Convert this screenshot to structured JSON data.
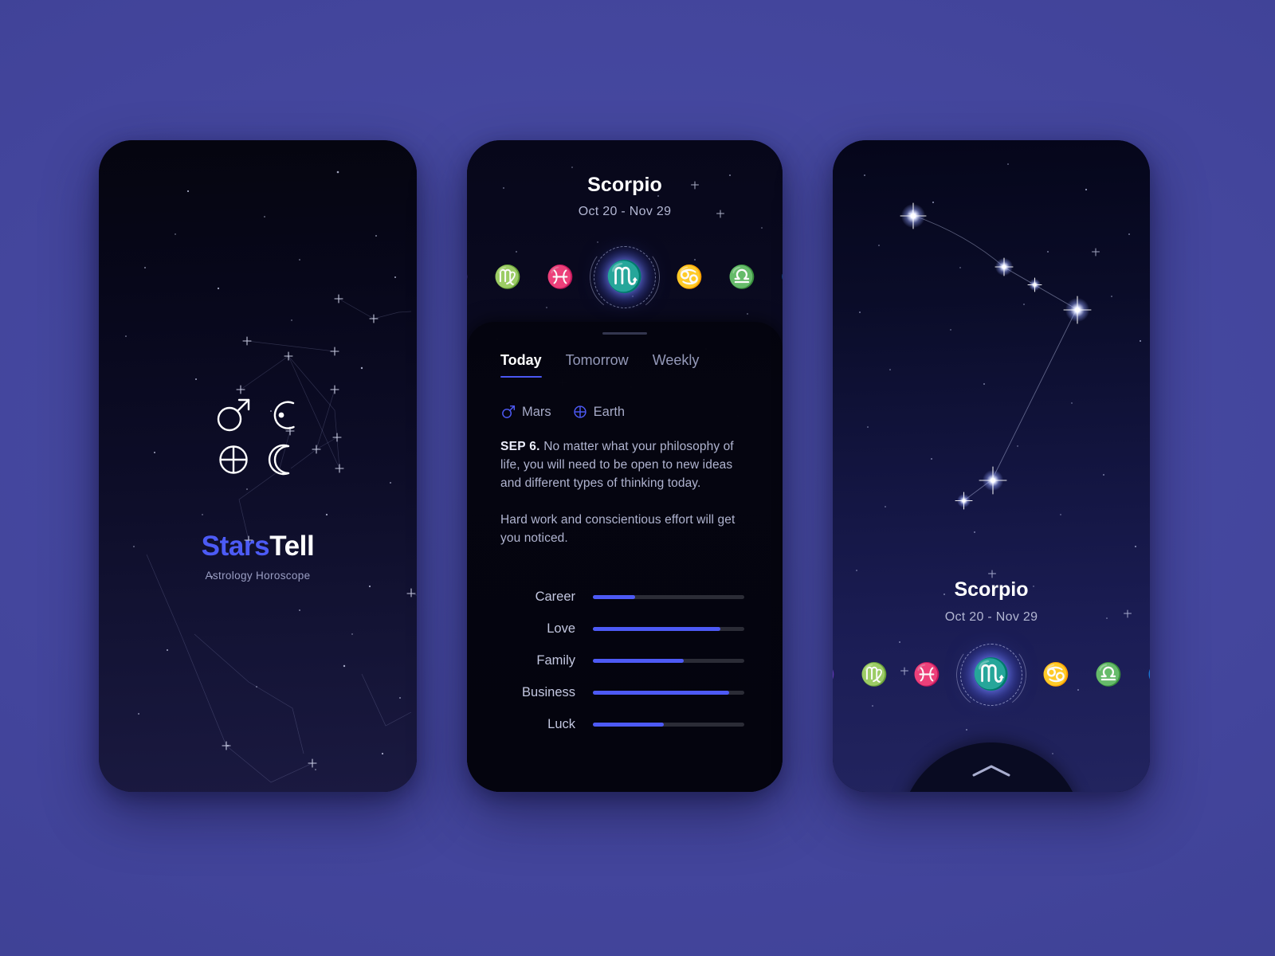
{
  "app": {
    "brand_primary": "Stars",
    "brand_secondary": "Tell",
    "tagline": "Astrology Horoscope",
    "accent_color": "#4d5af5",
    "page_background": "#43459c"
  },
  "splash": {
    "planet_icons": [
      "mars-icon",
      "sun-icon",
      "earth-icon",
      "moon-icon"
    ]
  },
  "detail": {
    "sign_name": "Scorpio",
    "sign_dates": "Oct 20 - Nov 29",
    "selected_glyph": "♏",
    "zodiac_rail": [
      {
        "name": "capricorn",
        "glyph": "♑",
        "dim": "edge"
      },
      {
        "name": "virgo",
        "glyph": "♍",
        "dim": "faint"
      },
      {
        "name": "pisces",
        "glyph": "♓",
        "dim": "normal"
      },
      {
        "name": "scorpio",
        "glyph": "♏",
        "dim": "selected"
      },
      {
        "name": "cancer",
        "glyph": "♋",
        "dim": "normal"
      },
      {
        "name": "libra",
        "glyph": "♎",
        "dim": "faint"
      },
      {
        "name": "sagittarius",
        "glyph": "♐",
        "dim": "edge"
      }
    ],
    "tabs": [
      {
        "label": "Today",
        "active": true
      },
      {
        "label": "Tomorrow",
        "active": false
      },
      {
        "label": "Weekly",
        "active": false
      }
    ],
    "planets": [
      {
        "name": "Mars",
        "icon": "mars-icon"
      },
      {
        "name": "Earth",
        "icon": "earth-icon"
      }
    ],
    "date_label": "SEP 6.",
    "paragraph_1": "No matter what your philosophy of life, you will need to be open to new ideas and different types of thinking today.",
    "paragraph_2": "Hard work and conscientious effort will get you noticed.",
    "stats": [
      {
        "label": "Career",
        "value": 28
      },
      {
        "label": "Love",
        "value": 84
      },
      {
        "label": "Family",
        "value": 60
      },
      {
        "label": "Business",
        "value": 90
      },
      {
        "label": "Luck",
        "value": 47
      }
    ]
  },
  "constellation_view": {
    "sign_name": "Scorpio",
    "sign_dates": "Oct 20 - Nov 29",
    "selected_glyph": "♏",
    "zodiac_rail": [
      {
        "name": "capricorn",
        "glyph": "♑",
        "dim": "edge"
      },
      {
        "name": "virgo",
        "glyph": "♍",
        "dim": "faint"
      },
      {
        "name": "pisces",
        "glyph": "♓",
        "dim": "normal"
      },
      {
        "name": "scorpio",
        "glyph": "♏",
        "dim": "selected"
      },
      {
        "name": "cancer",
        "glyph": "♋",
        "dim": "normal"
      },
      {
        "name": "libra",
        "glyph": "♎",
        "dim": "faint"
      },
      {
        "name": "sagittarius",
        "glyph": "♐",
        "dim": "edge"
      }
    ],
    "sheet_handle": "chevron-up-icon"
  }
}
